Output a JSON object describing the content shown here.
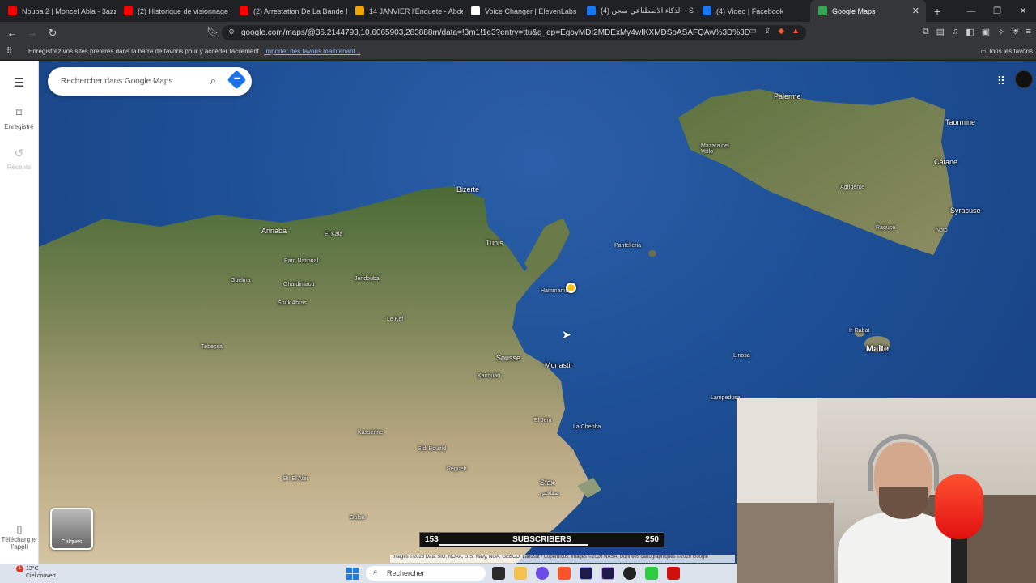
{
  "browser": {
    "tabs": [
      {
        "title": "Nouba 2 | Moncef Abla - 3azza",
        "color": "#ff0000",
        "active": false
      },
      {
        "title": "(2) Historique de visionnage -",
        "color": "#ff0000",
        "active": false
      },
      {
        "title": "(2) Arrestation De La Bande Ma",
        "color": "#ff0000",
        "active": false
      },
      {
        "title": "14 JANVIER l'Enquete - Abdela",
        "color": "#f0a500",
        "active": false
      },
      {
        "title": "Voice Changer | ElevenLabs",
        "color": "#ffffff",
        "active": false
      },
      {
        "title": "(4) الذكاء الاصطناعي سجن - Sea",
        "color": "#1877f2",
        "active": false
      },
      {
        "title": "(4) Video | Facebook",
        "color": "#1877f2",
        "active": false
      },
      {
        "title": "Google Maps",
        "color": "#34a853",
        "active": true
      }
    ],
    "new_tab": "+",
    "url": "google.com/maps/@36.2144793,10.6065903,283888m/data=!3m1!1e3?entry=ttu&g_ep=EgoyMDI2MDExMy4wIKXMDSoASAFQAw%3D%3D",
    "bookmarks_bar": {
      "message": "Enregistrez vos sites préférés dans la barre de favoris pour y accéder facilement.",
      "import_link": "Importer des favoris maintenant...",
      "all_favorites": "Tous les favoris"
    }
  },
  "maps": {
    "search_placeholder": "Rechercher dans Google Maps",
    "rail": {
      "saved": "Enregistré",
      "recent": "Récents",
      "download": "Télécharg er l'appli"
    },
    "layers_label": "Calques",
    "attribution": "Images ©2026 Data SIO, NOAA, U.S. Navy, NGA, GEBCO, Landsat / Copernicus, Images ©2026 NASA, Données cartographiques ©2026 Google",
    "places": {
      "palermo": "Palerme",
      "taormina": "Taormine",
      "catania": "Catane",
      "syracuse": "Syracuse",
      "agrigento": "Agrigente",
      "mazara": "Mazara del Vallo",
      "ragusa": "Raguse",
      "noto": "Noto",
      "pantelleria": "Pantelleria",
      "rabat": "Ir-Rabat",
      "malta": "Malte",
      "linosa": "Linosa",
      "lampedusa": "Lampedusa",
      "bizerte": "Bizerte",
      "tunis": "Tunis",
      "hammamet": "Hammamet",
      "annaba": "Annaba",
      "elkala": "El Kala",
      "guelma": "Guelma",
      "ghardimaou": "Ghardimaou",
      "souk_ahras": "Souk Ahras",
      "jendouba": "Jendouba",
      "parc": "Parc National",
      "sousse": "Sousse",
      "kairouan": "Kairouan",
      "monastir": "Monastir",
      "eljem": "El Jem",
      "chebba": "La Chebba",
      "kasserine": "Kasserine",
      "sidibouzid": "Sidi Bouzid",
      "regueb": "Regueb",
      "sfax": "Sfax",
      "sfax_ar": "صفاقس",
      "bir_elater": "Bir El Ater",
      "gafsa": "Gafsa",
      "tebessa": "Tébessa",
      "le_kef": "Le Kef"
    }
  },
  "subscribers": {
    "current": "153",
    "label": "SUBSCRIBERS",
    "goal": "250",
    "progress": 0.61
  },
  "taskbar": {
    "weather_temp": "13°C",
    "weather_desc": "Ciel couvert",
    "notification_count": "1",
    "search_placeholder": "Rechercher"
  }
}
